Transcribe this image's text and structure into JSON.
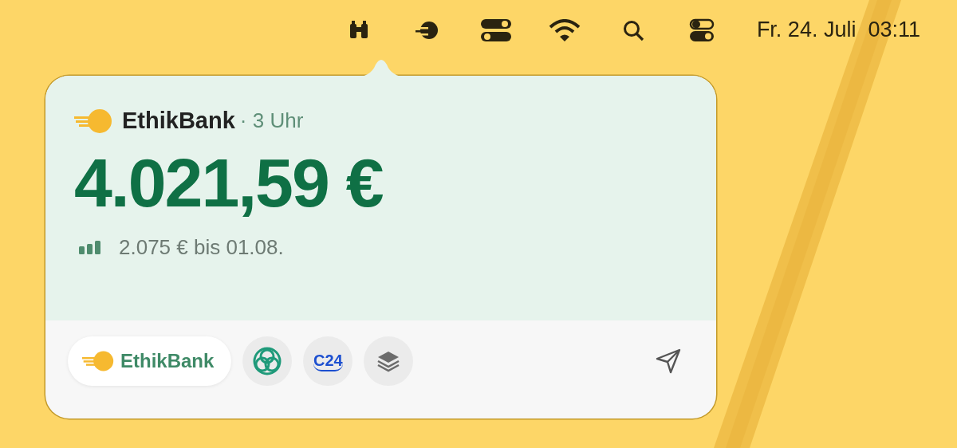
{
  "menu_bar": {
    "items": [
      {
        "kind": "binoculars"
      },
      {
        "kind": "coin"
      },
      {
        "kind": "toggles"
      },
      {
        "kind": "wifi"
      },
      {
        "kind": "search"
      },
      {
        "kind": "switch"
      }
    ],
    "clock": "Fr. 24. Juli  03:11"
  },
  "popover": {
    "bank": "EthikBank",
    "age": "· 3 Uhr",
    "balance": "4.021,59 €",
    "forecast": "2.075 € bis 01.08.",
    "accounts": [
      {
        "kind": "coin",
        "label": "EthikBank",
        "selected": true
      },
      {
        "kind": "knot",
        "selected": false
      },
      {
        "kind": "c24",
        "label": "C24",
        "selected": false
      },
      {
        "kind": "stack",
        "selected": false
      }
    ]
  }
}
